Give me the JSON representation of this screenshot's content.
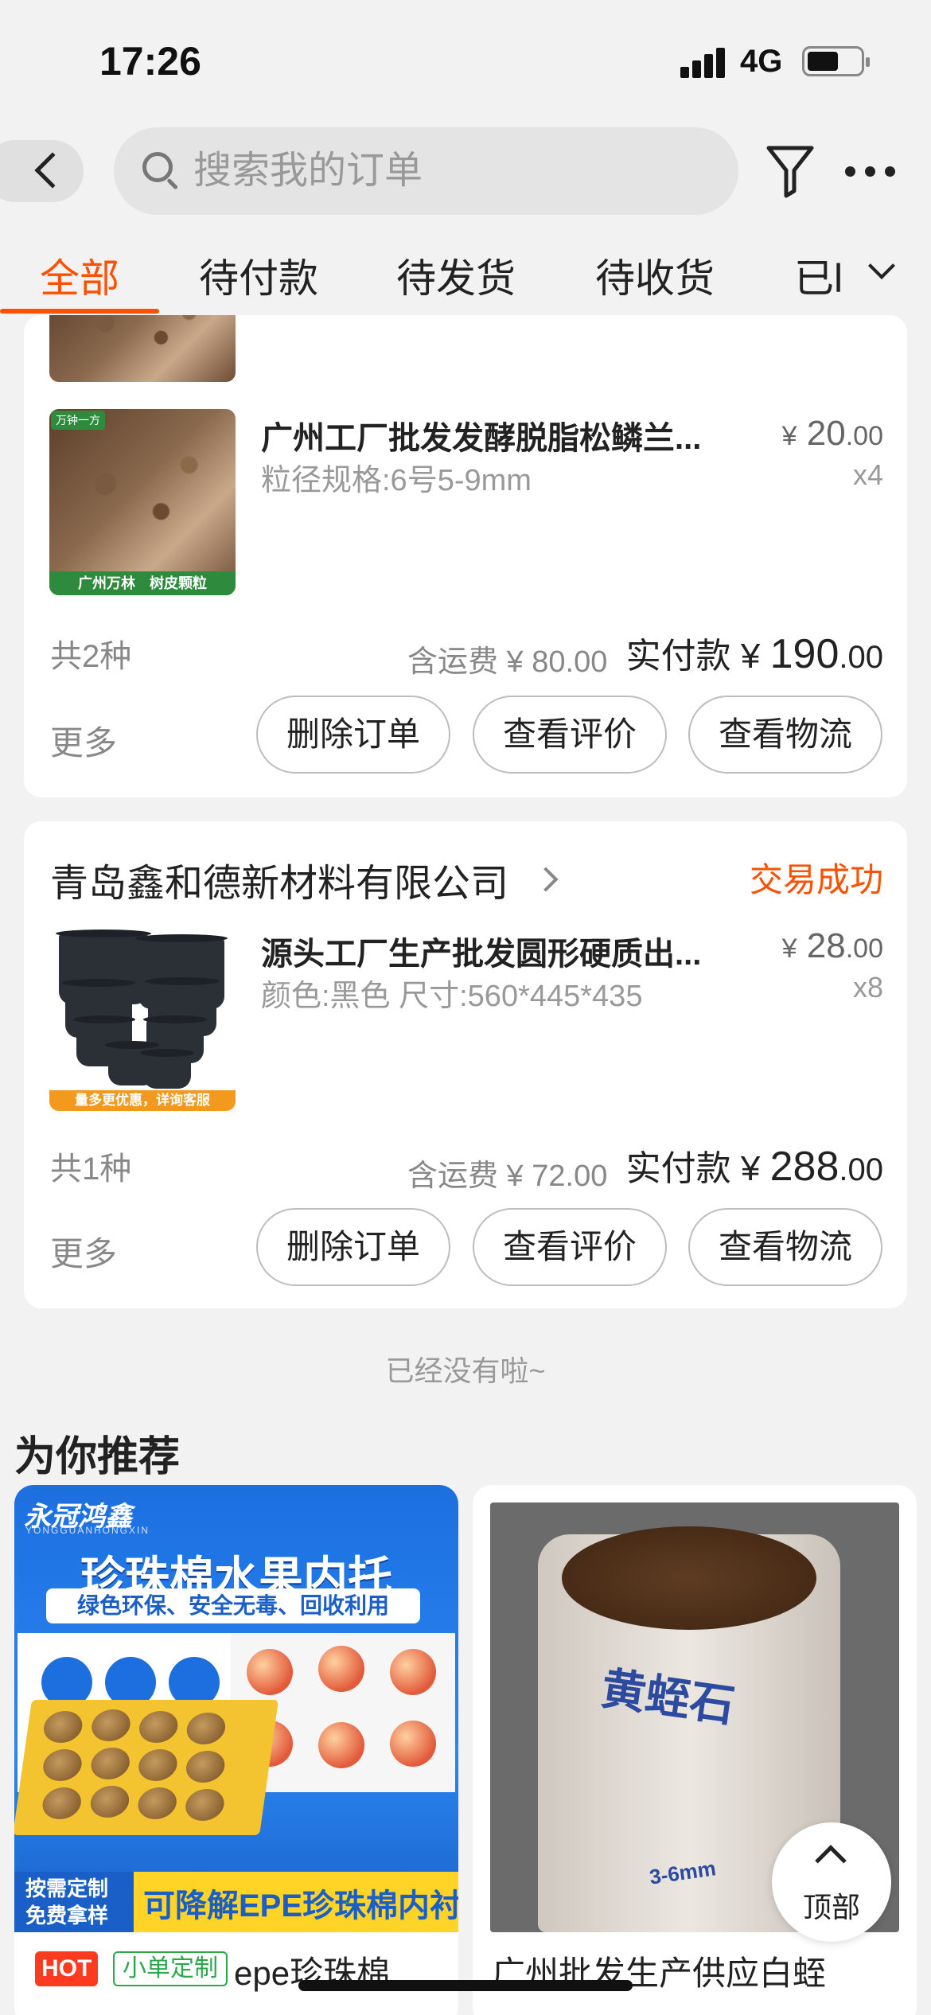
{
  "status_bar": {
    "time": "17:26",
    "network": "4G"
  },
  "search": {
    "placeholder": "搜索我的订单"
  },
  "tabs": [
    {
      "label": "全部",
      "active": true
    },
    {
      "label": "待付款",
      "active": false
    },
    {
      "label": "待发货",
      "active": false
    },
    {
      "label": "待收货",
      "active": false
    },
    {
      "label": "已l",
      "active": false
    }
  ],
  "colors": {
    "accent": "#ff5000",
    "success_text": "#ff5000"
  },
  "order1": {
    "item": {
      "title": "广州工厂批发发酵脱脂松鳞兰...",
      "spec": "粒径规格:6号5-9mm",
      "price_symbol": "¥",
      "price_int": "20",
      "price_dec": ".00",
      "qty": "x4",
      "thumb_tag": "万钟一方",
      "thumb_band": "广州万林　树皮颗粒"
    },
    "kinds": "共2种",
    "shipping": "含运费 ¥ 80.00",
    "paid_label": "实付款",
    "paid_symbol": "¥",
    "paid_int": "190",
    "paid_dec": ".00",
    "more": "更多",
    "buttons": {
      "delete": "删除订单",
      "review": "查看评价",
      "logistics": "查看物流"
    }
  },
  "order2": {
    "shop_name": "青岛鑫和德新材料有限公司",
    "status": "交易成功",
    "item": {
      "title": "源头工厂生产批发圆形硬质出...",
      "spec": "颜色:黑色 尺寸:560*445*435",
      "price_symbol": "¥",
      "price_int": "28",
      "price_dec": ".00",
      "qty": "x8",
      "thumb_band": "量多更优惠，详询客服"
    },
    "kinds": "共1种",
    "shipping": "含运费 ¥ 72.00",
    "paid_label": "实付款",
    "paid_symbol": "¥",
    "paid_int": "288",
    "paid_dec": ".00",
    "more": "更多",
    "buttons": {
      "delete": "删除订单",
      "review": "查看评价",
      "logistics": "查看物流"
    }
  },
  "end_text": "已经没有啦~",
  "recommend": {
    "title": "为你推荐",
    "items": [
      {
        "brand": "永冠鸿鑫",
        "brand_sub": "YONGGUANHONGXIN",
        "banner": "珍珠棉水果内托",
        "sub": "绿色环保、安全无毒、回收利用",
        "corner": "按需定制 免费拿样",
        "strip": "可降解EPE珍珠棉内衬",
        "hot": "HOT",
        "badge": "小单定制",
        "caption": "epe珍珠棉"
      },
      {
        "sack_text": "黄蛭石",
        "sack_size": "3-6mm",
        "caption": "广州批发生产供应白蛭"
      }
    ]
  },
  "top_button": "顶部"
}
